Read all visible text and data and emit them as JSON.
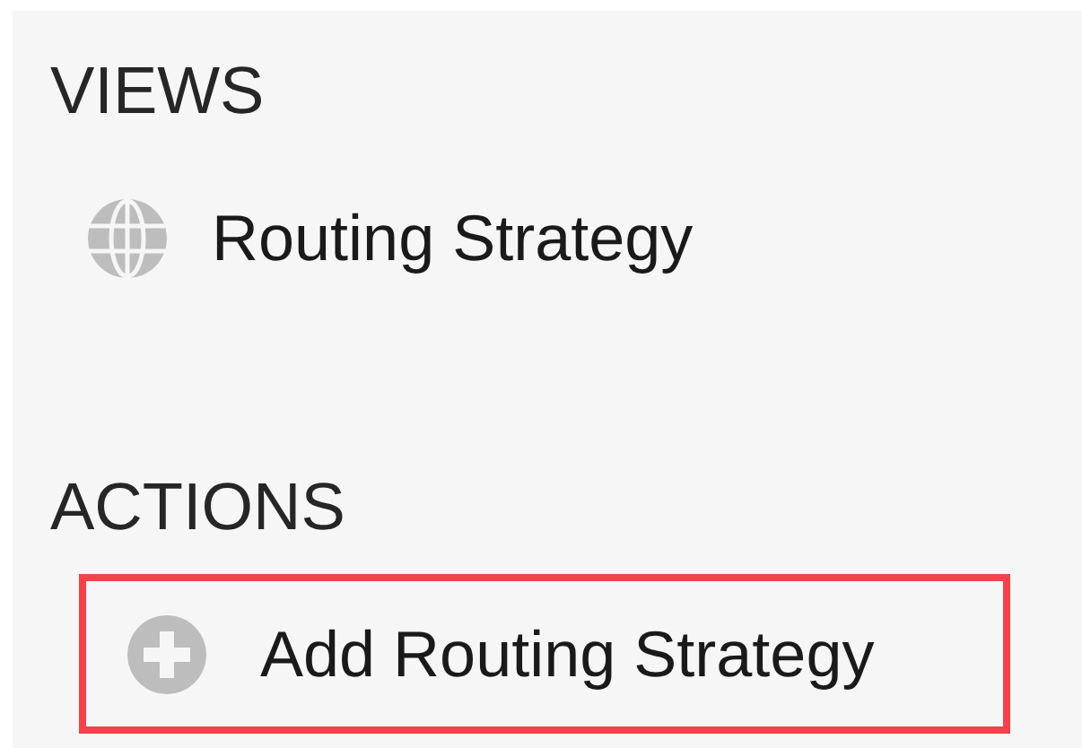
{
  "sections": [
    {
      "heading": "VIEWS",
      "items": [
        {
          "kind": "view",
          "label": "Routing Strategy",
          "highlighted": false
        }
      ]
    },
    {
      "heading": "ACTIONS",
      "items": [
        {
          "kind": "add",
          "label": "Add Routing Strategy",
          "highlighted": true
        }
      ]
    }
  ]
}
